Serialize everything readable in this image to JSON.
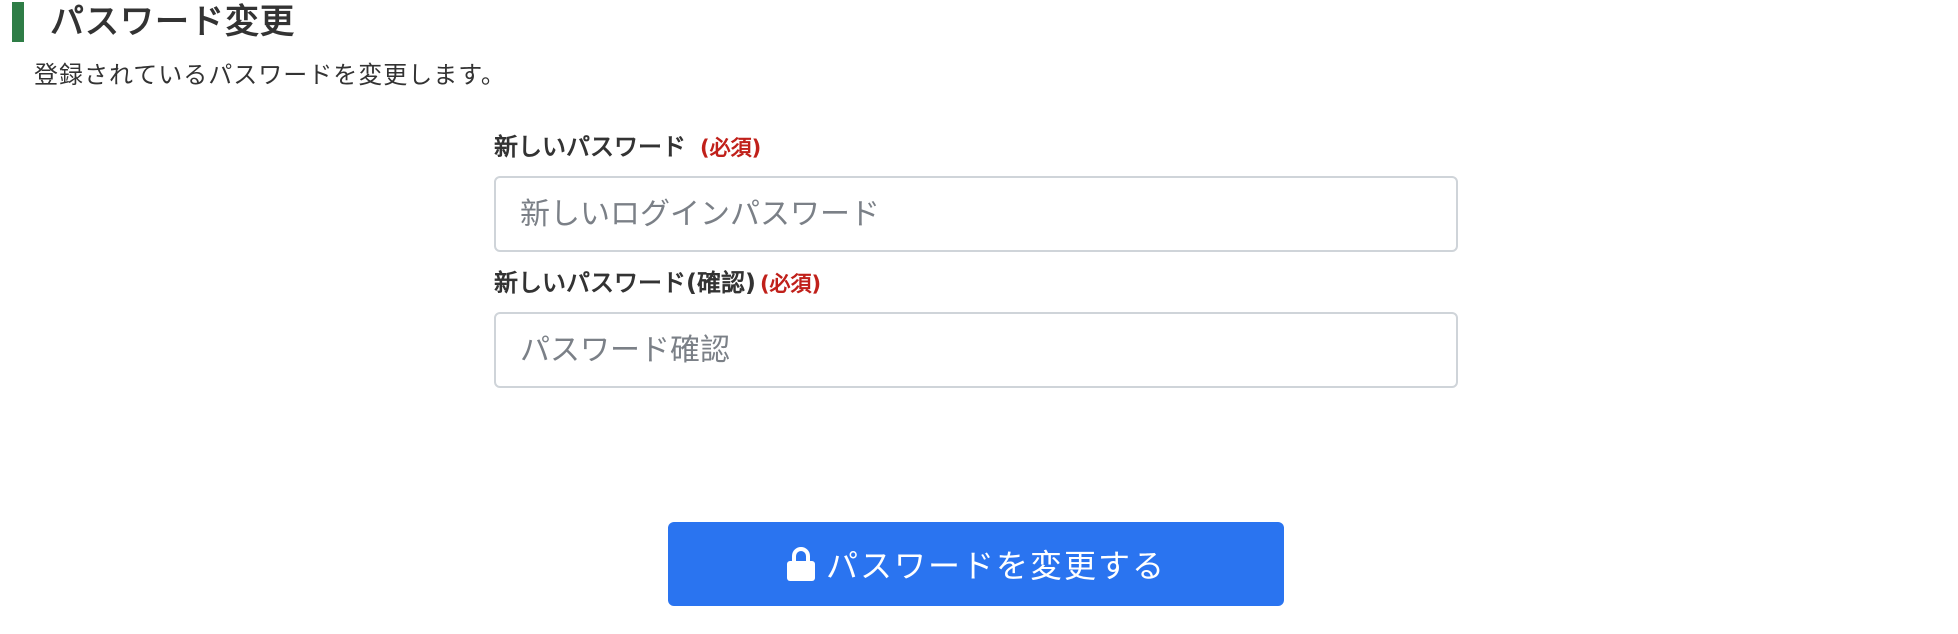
{
  "header": {
    "title": "パスワード変更",
    "description": "登録されているパスワードを変更します。"
  },
  "form": {
    "new_password": {
      "label": "新しいパスワード",
      "required_tag": "(必須)",
      "placeholder": "新しいログインパスワード",
      "value": ""
    },
    "confirm_password": {
      "label": "新しいパスワード(確認)",
      "required_tag": "(必須)",
      "placeholder": "パスワード確認",
      "value": ""
    }
  },
  "submit": {
    "label": "パスワードを変更する",
    "icon": "lock-icon"
  },
  "colors": {
    "accent": "#2e7d46",
    "primary": "#2a74f0",
    "required": "#c0201a"
  }
}
